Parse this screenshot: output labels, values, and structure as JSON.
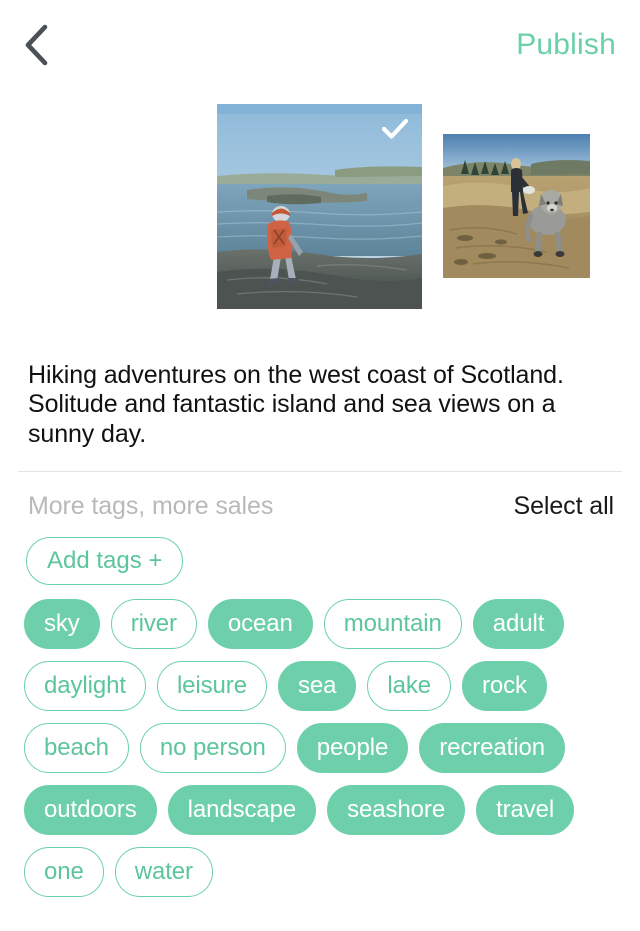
{
  "header": {
    "back_icon": "chevron-left-icon",
    "publish_label": "Publish"
  },
  "thumbnails": {
    "items": [
      {
        "alt": "Hiker with orange backpack standing on coastal rocks above the sea",
        "selected": true,
        "check_icon": "check-icon"
      },
      {
        "alt": "Person walking a shaggy grey dog on a sandy coastal trail",
        "selected": false
      }
    ]
  },
  "description": {
    "text": "Hiking adventures on the west coast of Scotland. Solitude and fantastic island and sea views on a sunny day."
  },
  "tags_section": {
    "hint": "More tags, more sales",
    "select_all_label": "Select all",
    "add_tags_label": "Add tags +",
    "rows": [
      [
        {
          "label": "sky",
          "selected": true
        },
        {
          "label": "river",
          "selected": false
        },
        {
          "label": "ocean",
          "selected": true
        },
        {
          "label": "mountain",
          "selected": false
        },
        {
          "label": "adult",
          "selected": true
        }
      ],
      [
        {
          "label": "daylight",
          "selected": false
        },
        {
          "label": "leisure",
          "selected": false
        },
        {
          "label": "sea",
          "selected": true
        },
        {
          "label": "lake",
          "selected": false
        },
        {
          "label": "rock",
          "selected": true
        }
      ],
      [
        {
          "label": "beach",
          "selected": false
        },
        {
          "label": "no person",
          "selected": false
        },
        {
          "label": "people",
          "selected": true
        },
        {
          "label": "recreation",
          "selected": true
        }
      ],
      [
        {
          "label": "outdoors",
          "selected": true
        },
        {
          "label": "landscape",
          "selected": true
        },
        {
          "label": "seashore",
          "selected": true
        },
        {
          "label": "travel",
          "selected": true
        }
      ],
      [
        {
          "label": "one",
          "selected": false
        },
        {
          "label": "water",
          "selected": false
        }
      ]
    ]
  },
  "colors": {
    "accent_green": "#6ed0ab",
    "accent_green_text": "#5cc69a",
    "publish_green": "#6ad1a6",
    "hint_grey": "#b9b9b9",
    "text_dark": "#111111",
    "divider": "#e4e4e4"
  }
}
